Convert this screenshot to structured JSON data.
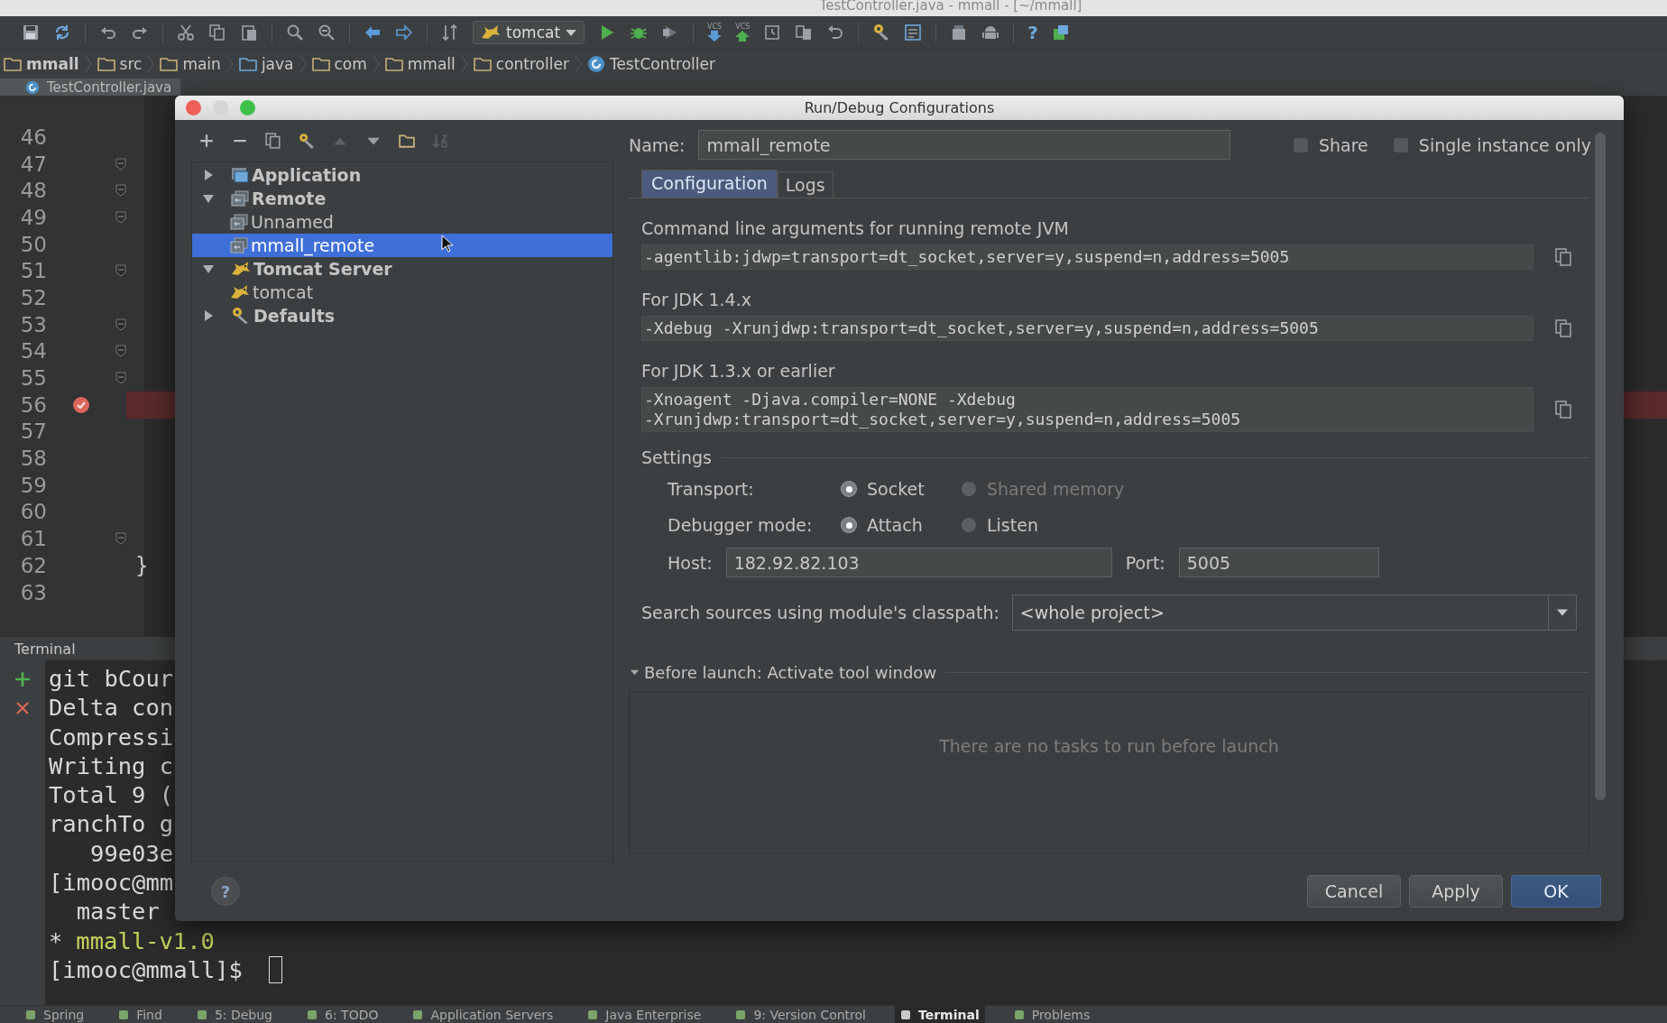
{
  "window": {
    "title": "TestController.java - mmall - [~/mmall]"
  },
  "toolbar": {
    "run_config": "tomcat",
    "vcs_labels": [
      "VCS",
      "VCS"
    ],
    "help": "?"
  },
  "breadcrumbs": [
    {
      "label": "mmall",
      "kind": "project"
    },
    {
      "label": "src",
      "kind": "folder"
    },
    {
      "label": "main",
      "kind": "folder"
    },
    {
      "label": "java",
      "kind": "source"
    },
    {
      "label": "com",
      "kind": "folder"
    },
    {
      "label": "mmall",
      "kind": "folder"
    },
    {
      "label": "controller",
      "kind": "folder"
    },
    {
      "label": "TestController",
      "kind": "class"
    }
  ],
  "editor_tabs": [
    {
      "label": "TestController.java",
      "selected": true
    }
  ],
  "editor": {
    "lines": [
      {
        "number": "46",
        "fold": false,
        "breakpoint": false
      },
      {
        "number": "47",
        "fold": true,
        "breakpoint": false
      },
      {
        "number": "48",
        "fold": true,
        "breakpoint": false
      },
      {
        "number": "49",
        "fold": true,
        "breakpoint": false
      },
      {
        "number": "50",
        "fold": false,
        "breakpoint": false
      },
      {
        "number": "51",
        "fold": true,
        "breakpoint": false
      },
      {
        "number": "52",
        "fold": false,
        "breakpoint": false
      },
      {
        "number": "53",
        "fold": true,
        "breakpoint": false
      },
      {
        "number": "54",
        "fold": true,
        "breakpoint": false
      },
      {
        "number": "55",
        "fold": true,
        "breakpoint": false
      },
      {
        "number": "56",
        "fold": false,
        "breakpoint": true
      },
      {
        "number": "57",
        "fold": false,
        "breakpoint": false
      },
      {
        "number": "58",
        "fold": false,
        "breakpoint": false
      },
      {
        "number": "59",
        "fold": false,
        "breakpoint": false
      },
      {
        "number": "60",
        "fold": false,
        "breakpoint": false
      },
      {
        "number": "61",
        "fold": true,
        "breakpoint": false
      },
      {
        "number": "62",
        "fold": false,
        "breakpoint": false,
        "code": "}"
      },
      {
        "number": "63",
        "fold": false,
        "breakpoint": false
      }
    ]
  },
  "terminal": {
    "title": "Terminal",
    "lines": [
      {
        "kind": "plain",
        "text": "git bCour"
      },
      {
        "kind": "plain",
        "text": "Delta con"
      },
      {
        "kind": "plain",
        "text": "Compressi"
      },
      {
        "kind": "plain",
        "text": "Writing c"
      },
      {
        "kind": "plain",
        "text": "Total 9 ("
      },
      {
        "kind": "plain",
        "text": "ranchTo g"
      },
      {
        "kind": "plain",
        "text": "   99e03e"
      },
      {
        "kind": "plain",
        "text": "[imooc@mm"
      },
      {
        "kind": "plain",
        "text": "  master"
      },
      {
        "kind": "branch",
        "marker": "*",
        "text": "mmall-v1.0"
      },
      {
        "kind": "prompt",
        "text": "[imooc@mmall]$"
      }
    ]
  },
  "dialog": {
    "title": "Run/Debug Configurations",
    "tree": [
      {
        "label": "Application",
        "kind": "application",
        "expanded": false,
        "selected": false
      },
      {
        "label": "Remote",
        "kind": "remote",
        "expanded": true,
        "selected": false,
        "children": [
          {
            "label": "Unnamed",
            "kind": "remote",
            "selected": false
          },
          {
            "label": "mmall_remote",
            "kind": "remote",
            "selected": true
          }
        ]
      },
      {
        "label": "Tomcat Server",
        "kind": "tomcat",
        "expanded": true,
        "selected": false,
        "children": [
          {
            "label": "tomcat",
            "kind": "tomcat",
            "selected": false
          }
        ]
      },
      {
        "label": "Defaults",
        "kind": "defaults",
        "expanded": false,
        "selected": false
      }
    ],
    "help": "?",
    "name": {
      "label": "Name:",
      "value": "mmall_remote"
    },
    "options": [
      {
        "label": "Share",
        "checked": false
      },
      {
        "label": "Single instance only",
        "checked": false
      }
    ],
    "tabs": [
      {
        "label": "Configuration",
        "selected": true
      },
      {
        "label": "Logs",
        "selected": false
      }
    ],
    "arguments": [
      {
        "label": "Command line arguments for running remote JVM",
        "lines": [
          "-agentlib:jdwp=transport=dt_socket,server=y,suspend=n,address=5005"
        ]
      },
      {
        "label": "For JDK 1.4.x",
        "lines": [
          "-Xdebug -Xrunjdwp:transport=dt_socket,server=y,suspend=n,address=5005"
        ]
      },
      {
        "label": "For JDK 1.3.x or earlier",
        "lines": [
          "-Xnoagent -Djava.compiler=NONE -Xdebug",
          "-Xrunjdwp:transport=dt_socket,server=y,suspend=n,address=5005"
        ]
      }
    ],
    "settings": {
      "title": "Settings",
      "groups": [
        {
          "label": "Transport:",
          "options": [
            {
              "label": "Socket",
              "selected": true,
              "disabled": false
            },
            {
              "label": "Shared memory",
              "selected": false,
              "disabled": true
            }
          ]
        },
        {
          "label": "Debugger mode:",
          "options": [
            {
              "label": "Attach",
              "selected": true,
              "disabled": false
            },
            {
              "label": "Listen",
              "selected": false,
              "disabled": false
            }
          ]
        }
      ],
      "host": {
        "label": "Host:",
        "value": "182.92.82.103"
      },
      "port": {
        "label": "Port:",
        "value": "5005"
      }
    },
    "classpath": {
      "label": "Search sources using module's classpath:",
      "value": "<whole project>"
    },
    "before_launch": {
      "title": "Before launch: Activate tool window",
      "expanded": true,
      "empty_text": "There are no tasks to run before launch"
    },
    "buttons": [
      {
        "label": "Cancel",
        "kind": "default"
      },
      {
        "label": "Apply",
        "kind": "default"
      },
      {
        "label": "OK",
        "kind": "primary"
      }
    ]
  },
  "status_bar": {
    "tabs": [
      {
        "label": "Spring",
        "selected": false
      },
      {
        "label": "Find",
        "selected": false
      },
      {
        "label": "5: Debug",
        "selected": false
      },
      {
        "label": "6: TODO",
        "selected": false
      },
      {
        "label": "Application Servers",
        "selected": false
      },
      {
        "label": "Java Enterprise",
        "selected": false
      },
      {
        "label": "9: Version Control",
        "selected": false
      },
      {
        "label": "Terminal",
        "selected": true
      },
      {
        "label": "Problems",
        "selected": false
      }
    ]
  }
}
